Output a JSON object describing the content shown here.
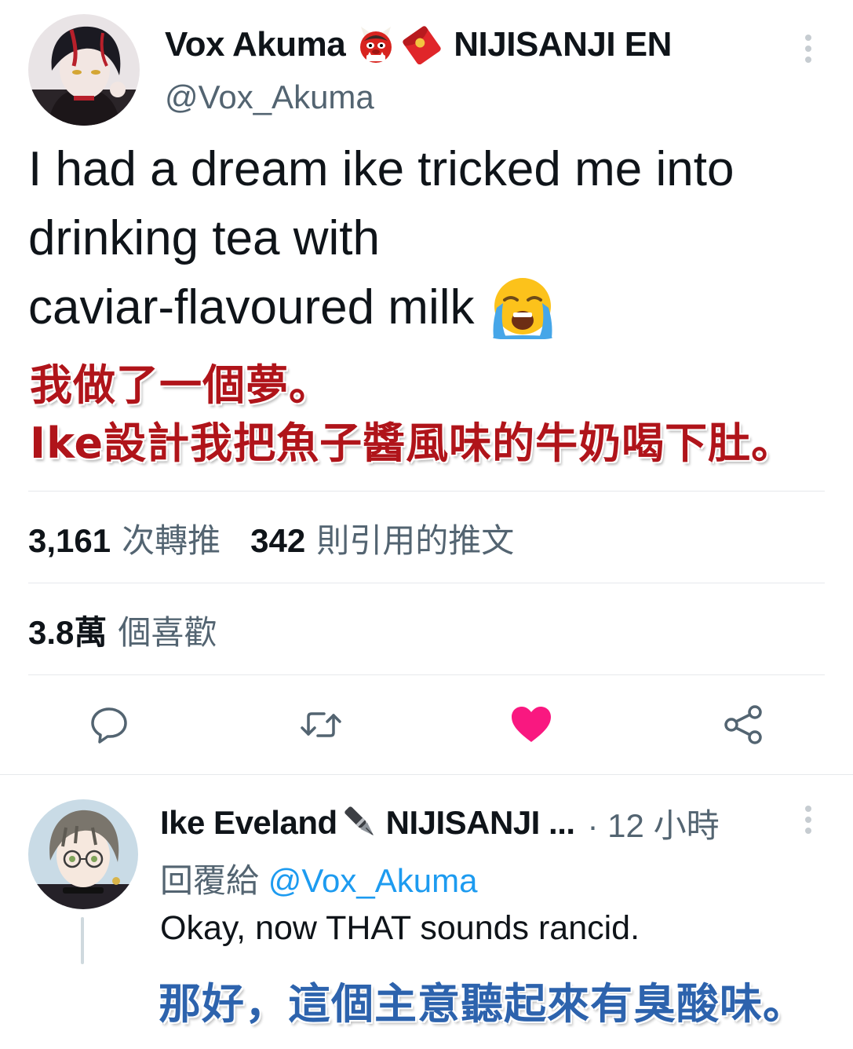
{
  "tweet": {
    "author": {
      "display_name": "Vox Akuma",
      "org": "NIJISANJI EN",
      "handle": "@Vox_Akuma",
      "name_emojis": [
        "japanese-ogre-icon",
        "red-envelope-icon"
      ]
    },
    "text_lines": [
      "I had a dream ike tricked me into",
      "drinking tea with",
      "caviar-flavoured milk"
    ],
    "text_emoji": "loudly-crying-face-icon",
    "caption_lines": [
      "我做了一個夢。",
      "Ike設計我把魚子醬風味的牛奶喝下肚。"
    ],
    "stats": {
      "retweets_count": "3,161",
      "retweets_label": "次轉推",
      "quotes_count": "342",
      "quotes_label": "則引用的推文",
      "likes_count": "3.8萬",
      "likes_label": "個喜歡"
    },
    "actions": [
      "reply-icon",
      "retweet-icon",
      "like-icon",
      "share-icon"
    ],
    "liked": true
  },
  "reply": {
    "author": {
      "display_name": "Ike Eveland",
      "org": "NIJISANJI ...",
      "name_emoji": "fountain-pen-icon"
    },
    "time": "· 12 小時",
    "reply_to_label": "回覆給",
    "reply_to_handle": "@Vox_Akuma",
    "text": "Okay, now THAT sounds rancid.",
    "caption": "那好，這個主意聽起來有臭酸味。"
  },
  "colors": {
    "text_primary": "#0f1419",
    "text_secondary": "#536471",
    "mention": "#1d9bf0",
    "like": "#f91880",
    "caption_red": "#b0141a",
    "caption_blue": "#2d63ad",
    "divider": "#e6e9ec"
  }
}
